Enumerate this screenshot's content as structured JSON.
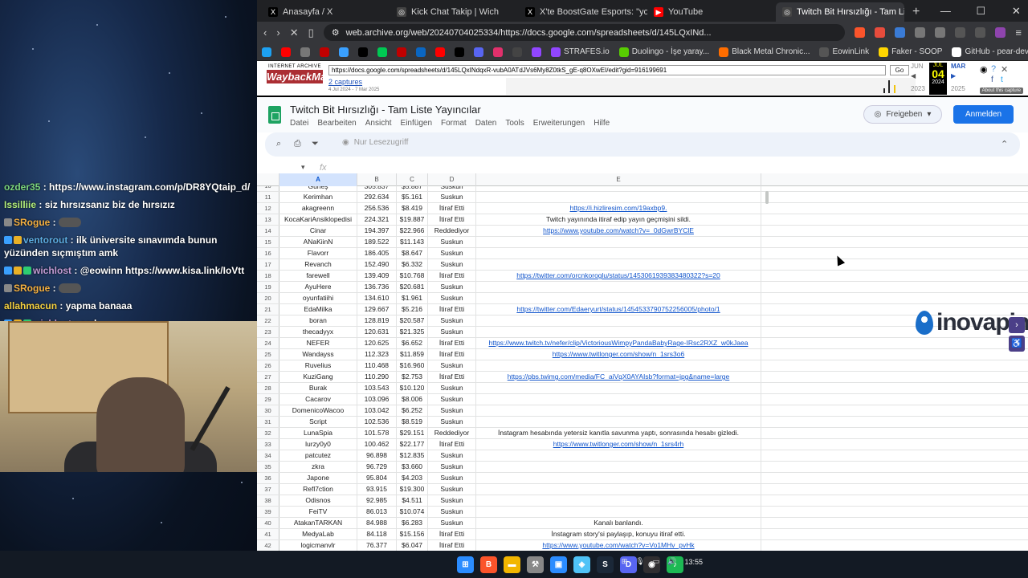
{
  "chat": [
    {
      "user": "ozder35",
      "color": "#7cd67c",
      "badges": [],
      "text": "https://www.instagram.com/p/DR8YQtaip_d/",
      "emote": false
    },
    {
      "user": "Issilliie",
      "color": "#b4f07b",
      "badges": [],
      "text": "siz hırsızsanız biz de hırsızız",
      "emote": false
    },
    {
      "user": "SRogue",
      "color": "#f5b041",
      "badges": [
        "#888888"
      ],
      "text": "",
      "emote": true
    },
    {
      "user": "ventorout",
      "color": "#5dade2",
      "badges": [
        "#3aa0ff",
        "#e9b026"
      ],
      "text": "ilk üniversite sınavımda bunun yüzünden sıçmıştım amk",
      "emote": false
    },
    {
      "user": "wichlost",
      "color": "#c39bd3",
      "badges": [
        "#3aa0ff",
        "#e9b026",
        "#2ecc71"
      ],
      "text": "@eowinn https://www.kisa.link/IoVtt",
      "emote": false
    },
    {
      "user": "SRogue",
      "color": "#f5b041",
      "badges": [
        "#888888"
      ],
      "text": "",
      "emote": true
    },
    {
      "user": "allahmacun",
      "color": "#f4d03f",
      "badges": [],
      "text": "yapma banaaa",
      "emote": false
    },
    {
      "user": "wichlost",
      "color": "#c39bd3",
      "badges": [
        "#3aa0ff",
        "#e9b026",
        "#2ecc71"
      ],
      "text": "eed",
      "emote": false
    }
  ],
  "browser": {
    "tabs": [
      {
        "label": "Anasayfa / X",
        "icon": "x-icon",
        "icon_char": "X",
        "icon_color": "#000000",
        "active": false
      },
      {
        "label": "Kick Chat Takip | Wich",
        "icon": "globe-icon",
        "icon_char": "◎",
        "icon_color": "#444444",
        "active": false
      },
      {
        "label": "X'te BoostGate Esports: \"yok kral yer",
        "icon": "x-icon",
        "icon_char": "X",
        "icon_color": "#000000",
        "active": false
      },
      {
        "label": "YouTube",
        "icon": "youtube-icon",
        "icon_char": "▶",
        "icon_color": "#ff0000",
        "active": false
      },
      {
        "label": "Twitch Bit Hırsızlığı - Tam Liste Y",
        "icon": "globe-icon",
        "icon_char": "◎",
        "icon_color": "#444444",
        "active": true
      }
    ],
    "new_tab": "+",
    "window_controls": {
      "minimize": "—",
      "maximize": "☐",
      "close": "✕"
    },
    "address": "web.archive.org/web/20240704025334/https://docs.google.com/spreadsheets/d/145LQxINd...",
    "bookmarks": [
      {
        "label": "",
        "color": "#1da1f2"
      },
      {
        "label": "",
        "color": "#ff0000"
      },
      {
        "label": "",
        "color": "#777777"
      },
      {
        "label": "",
        "color": "#c00000"
      },
      {
        "label": "",
        "color": "#3aa0ff"
      },
      {
        "label": "",
        "color": "#000000"
      },
      {
        "label": "",
        "color": "#00c853"
      },
      {
        "label": "",
        "color": "#c00000"
      },
      {
        "label": "",
        "color": "#0a66c2"
      },
      {
        "label": "",
        "color": "#ff0000"
      },
      {
        "label": "",
        "color": "#000000"
      },
      {
        "label": "",
        "color": "#5865f2"
      },
      {
        "label": "",
        "color": "#e1306c"
      },
      {
        "label": "",
        "color": "#444444"
      },
      {
        "label": "",
        "color": "#9146ff"
      },
      {
        "label": "STRAFES.io",
        "color": "#9146ff"
      },
      {
        "label": "Duolingo - İşe yaray...",
        "color": "#58cc02"
      },
      {
        "label": "Black Metal Chronic...",
        "color": "#ff6d00"
      },
      {
        "label": "EowinLink",
        "color": "#555555"
      },
      {
        "label": "Faker - SOOP",
        "color": "#ffd600"
      },
      {
        "label": "GitHub - pear-devs/...",
        "color": "#ffffff"
      }
    ]
  },
  "wayback": {
    "logo_top": "INTERNET ARCHIVE",
    "logo_main": "WaybackMachine",
    "url": "https://docs.google.com/spreadsheets/d/145LQxINdqxR-vubA0ATdJVs6My8Z0tkS_gE-q8OXwEI/edit?gid=916199691",
    "go": "Go",
    "captures": "2 captures",
    "dates": "4 Jul 2024 - 7 Mar 2025",
    "prev_month": "JUN",
    "cur_month": "JUL",
    "cur_day": "04",
    "cur_year": "2024",
    "next_month": "MAR",
    "prev_year": "2023",
    "next_year": "2025",
    "about": "About this capture"
  },
  "sheet": {
    "title": "Twitch Bit Hırsızlığı - Tam Liste Yayıncılar",
    "menu": [
      "Datei",
      "Bearbeiten",
      "Ansicht",
      "Einfügen",
      "Format",
      "Daten",
      "Tools",
      "Erweiterungen",
      "Hilfe"
    ],
    "share": "Freigeben",
    "signin": "Anmelden",
    "readonly": "Nur Lesezugriff",
    "fx": "fx",
    "columns": [
      "A",
      "B",
      "C",
      "D",
      "E"
    ],
    "first_row": {
      "n": "10",
      "a": "Güneş",
      "b": "305.837",
      "c": "$5.887",
      "d": "Suskun",
      "e": "",
      "link": false
    },
    "rows": [
      {
        "n": "11",
        "a": "Kerimhan",
        "b": "292.634",
        "c": "$5.161",
        "d": "Suskun",
        "e": "",
        "link": false
      },
      {
        "n": "12",
        "a": "akagreenn",
        "b": "256.536",
        "c": "$8.419",
        "d": "İtiraf Etti",
        "e": "https://i.hizliresim.com/19axbp9.",
        "link": true
      },
      {
        "n": "13",
        "a": "KocaKariAnsiklopedisi",
        "b": "224.321",
        "c": "$19.887",
        "d": "İtiraf Etti",
        "e": "Twitch yayınında itiraf edip yayın geçmişini sildi.",
        "link": false
      },
      {
        "n": "14",
        "a": "Cinar",
        "b": "194.397",
        "c": "$22.966",
        "d": "Reddediyor",
        "e": "https://www.youtube.com/watch?v=_0dGwrBYClE",
        "link": true
      },
      {
        "n": "15",
        "a": "ANaKiinN",
        "b": "189.522",
        "c": "$11.143",
        "d": "Suskun",
        "e": "",
        "link": false
      },
      {
        "n": "16",
        "a": "Flavorr",
        "b": "186.405",
        "c": "$8.647",
        "d": "Suskun",
        "e": "",
        "link": false
      },
      {
        "n": "17",
        "a": "Revanch",
        "b": "152.490",
        "c": "$6.332",
        "d": "Suskun",
        "e": "",
        "link": false
      },
      {
        "n": "18",
        "a": "farewell",
        "b": "139.409",
        "c": "$10.768",
        "d": "İtiraf Etti",
        "e": "https://twitter.com/orcnkoroglu/status/1453061939383480322?s=20",
        "link": true
      },
      {
        "n": "19",
        "a": "AyuHere",
        "b": "136.736",
        "c": "$20.681",
        "d": "Suskun",
        "e": "",
        "link": false
      },
      {
        "n": "20",
        "a": "oyunfatiihi",
        "b": "134.610",
        "c": "$1.961",
        "d": "Suskun",
        "e": "",
        "link": false
      },
      {
        "n": "21",
        "a": "EdaMilka",
        "b": "129.667",
        "c": "$5.216",
        "d": "İtiraf Etti",
        "e": "https://twitter.com/Edaeryurt/status/1454533790752256005/photo/1",
        "link": true
      },
      {
        "n": "22",
        "a": "boran",
        "b": "128.819",
        "c": "$20.587",
        "d": "Suskun",
        "e": "",
        "link": false
      },
      {
        "n": "23",
        "a": "thecadyyx",
        "b": "120.631",
        "c": "$21.325",
        "d": "Suskun",
        "e": "",
        "link": false
      },
      {
        "n": "24",
        "a": "NEFER",
        "b": "120.625",
        "c": "$6.652",
        "d": "İtiraf Etti",
        "e": "https://www.twitch.tv/nefer/clip/VictoriousWimpyPandaBabyRage-IRsc2RXZ_w0kJaea",
        "link": true
      },
      {
        "n": "25",
        "a": "Wandayss",
        "b": "112.323",
        "c": "$11.859",
        "d": "İtiraf Etti",
        "e": "https://www.twitlonger.com/show/n_1srs3o6",
        "link": true
      },
      {
        "n": "26",
        "a": "Ruvelius",
        "b": "110.468",
        "c": "$16.960",
        "d": "Suskun",
        "e": "",
        "link": false
      },
      {
        "n": "27",
        "a": "KuziGang",
        "b": "110.290",
        "c": "$2.753",
        "d": "İtiraf Etti",
        "e": "https://pbs.twimg.com/media/FC_aiVqX0AYAIsb?format=jpg&name=large",
        "link": true
      },
      {
        "n": "28",
        "a": "Burak",
        "b": "103.543",
        "c": "$10.120",
        "d": "Suskun",
        "e": "",
        "link": false
      },
      {
        "n": "29",
        "a": "Cacarov",
        "b": "103.096",
        "c": "$8.006",
        "d": "Suskun",
        "e": "",
        "link": false
      },
      {
        "n": "30",
        "a": "DomenicoWacoo",
        "b": "103.042",
        "c": "$6.252",
        "d": "Suskun",
        "e": "",
        "link": false
      },
      {
        "n": "31",
        "a": "Script",
        "b": "102.536",
        "c": "$8.519",
        "d": "Suskun",
        "e": "",
        "link": false
      },
      {
        "n": "32",
        "a": "LunaSpia",
        "b": "101.578",
        "c": "$29.151",
        "d": "Reddediyor",
        "e": "İnstagram hesabında yetersiz kanıtla savunma yaptı, sonrasında hesabı gizledi.",
        "link": false
      },
      {
        "n": "33",
        "a": "lurzy0y0",
        "b": "100.462",
        "c": "$22.177",
        "d": "İtiraf Etti",
        "e": "https://www.twitlonger.com/show/n_1srs4rh",
        "link": true
      },
      {
        "n": "34",
        "a": "patcutez",
        "b": "96.898",
        "c": "$12.835",
        "d": "Suskun",
        "e": "",
        "link": false
      },
      {
        "n": "35",
        "a": "zkra",
        "b": "96.729",
        "c": "$3.660",
        "d": "Suskun",
        "e": "",
        "link": false
      },
      {
        "n": "36",
        "a": "Japone",
        "b": "95.804",
        "c": "$4.203",
        "d": "Suskun",
        "e": "",
        "link": false
      },
      {
        "n": "37",
        "a": "Refl7ction",
        "b": "93.915",
        "c": "$19.300",
        "d": "Suskun",
        "e": "",
        "link": false
      },
      {
        "n": "38",
        "a": "Odisnos",
        "b": "92.985",
        "c": "$4.511",
        "d": "Suskun",
        "e": "",
        "link": false
      },
      {
        "n": "39",
        "a": "FeiTV",
        "b": "86.013",
        "c": "$10.074",
        "d": "Suskun",
        "e": "",
        "link": false
      },
      {
        "n": "40",
        "a": "AtakanTARKAN",
        "b": "84.988",
        "c": "$6.283",
        "d": "Suskun",
        "e": "Kanalı banlandı.",
        "link": false
      },
      {
        "n": "41",
        "a": "MedyaLab",
        "b": "84.118",
        "c": "$15.156",
        "d": "İtiraf Etti",
        "e": "İnstagram story'si paylaşıp, konuyu itiraf etti.",
        "link": false
      },
      {
        "n": "42",
        "a": "logicmanvlr",
        "b": "76.377",
        "c": "$6.047",
        "d": "İtiraf Etti",
        "e": "https://www.youtube.com/watch?v=Vo1MHv_pvHk",
        "link": true
      }
    ]
  },
  "overlay": {
    "brand": "inovapin",
    "brand_color": "#1a6ec9"
  },
  "taskbar": {
    "apps": [
      {
        "name": "windows-icon",
        "color": "#2b8cff",
        "char": "⊞"
      },
      {
        "name": "brave-icon",
        "color": "#fb542b",
        "char": "B"
      },
      {
        "name": "folder-icon",
        "color": "#f2b600",
        "char": "▬"
      },
      {
        "name": "tool-icon",
        "color": "#888888",
        "char": "⚒"
      },
      {
        "name": "photos-icon",
        "color": "#2b8cff",
        "char": "▣"
      },
      {
        "name": "app-icon",
        "color": "#4fc3f7",
        "char": "◈"
      },
      {
        "name": "steam-icon",
        "color": "#1b2838",
        "char": "S"
      },
      {
        "name": "discord-icon",
        "color": "#5865f2",
        "char": "D"
      },
      {
        "name": "obs-icon",
        "color": "#302e31",
        "char": "◉"
      },
      {
        "name": "spotify-icon",
        "color": "#1db954",
        "char": "♪"
      }
    ],
    "time": "13:55"
  }
}
